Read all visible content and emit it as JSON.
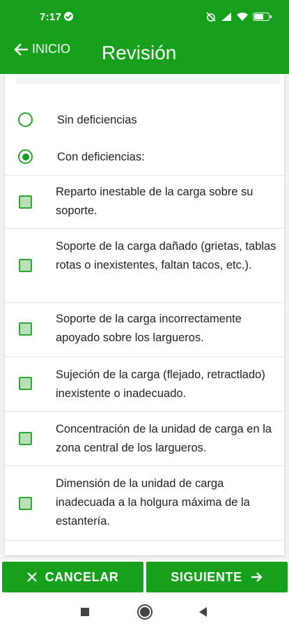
{
  "status_bar": {
    "time": "7:17",
    "icons": [
      "check-circle-icon",
      "alarm-off-icon",
      "signal-icon",
      "wifi-icon",
      "battery-icon"
    ]
  },
  "header": {
    "back_label": "INICIO",
    "title": "Revisión",
    "background_color": "#16a01c"
  },
  "review": {
    "radios": [
      {
        "label": "Sin deficiencias",
        "selected": false
      },
      {
        "label": "Con deficiencias:",
        "selected": true
      }
    ],
    "deficiencies": [
      {
        "label": "Reparto inestable de la carga sobre su soporte.",
        "checked": false
      },
      {
        "label": "Soporte de la carga dañado (grietas, tablas rotas o inexistentes, faltan tacos, etc.).",
        "checked": false
      },
      {
        "label": "Soporte de la carga incorrectamente apoyado sobre los largueros.",
        "checked": false
      },
      {
        "label": "Sujeción de la carga (flejado, retractlado) inexistente o inadecuado.",
        "checked": false
      },
      {
        "label": "Concentración de la unidad de carga en la zona central de los largueros.",
        "checked": false
      },
      {
        "label": "Dimensión de la unidad de carga inadecuada a la holgura máxima de la estantería.",
        "checked": false
      }
    ]
  },
  "actions": {
    "cancel_label": "CANCELAR",
    "cancel_icon": "close-icon",
    "next_label": "SIGUIENTE",
    "next_icon": "arrow-right-icon"
  },
  "nav": {
    "icons": [
      "recents-square-icon",
      "home-circle-icon",
      "back-triangle-icon"
    ]
  }
}
